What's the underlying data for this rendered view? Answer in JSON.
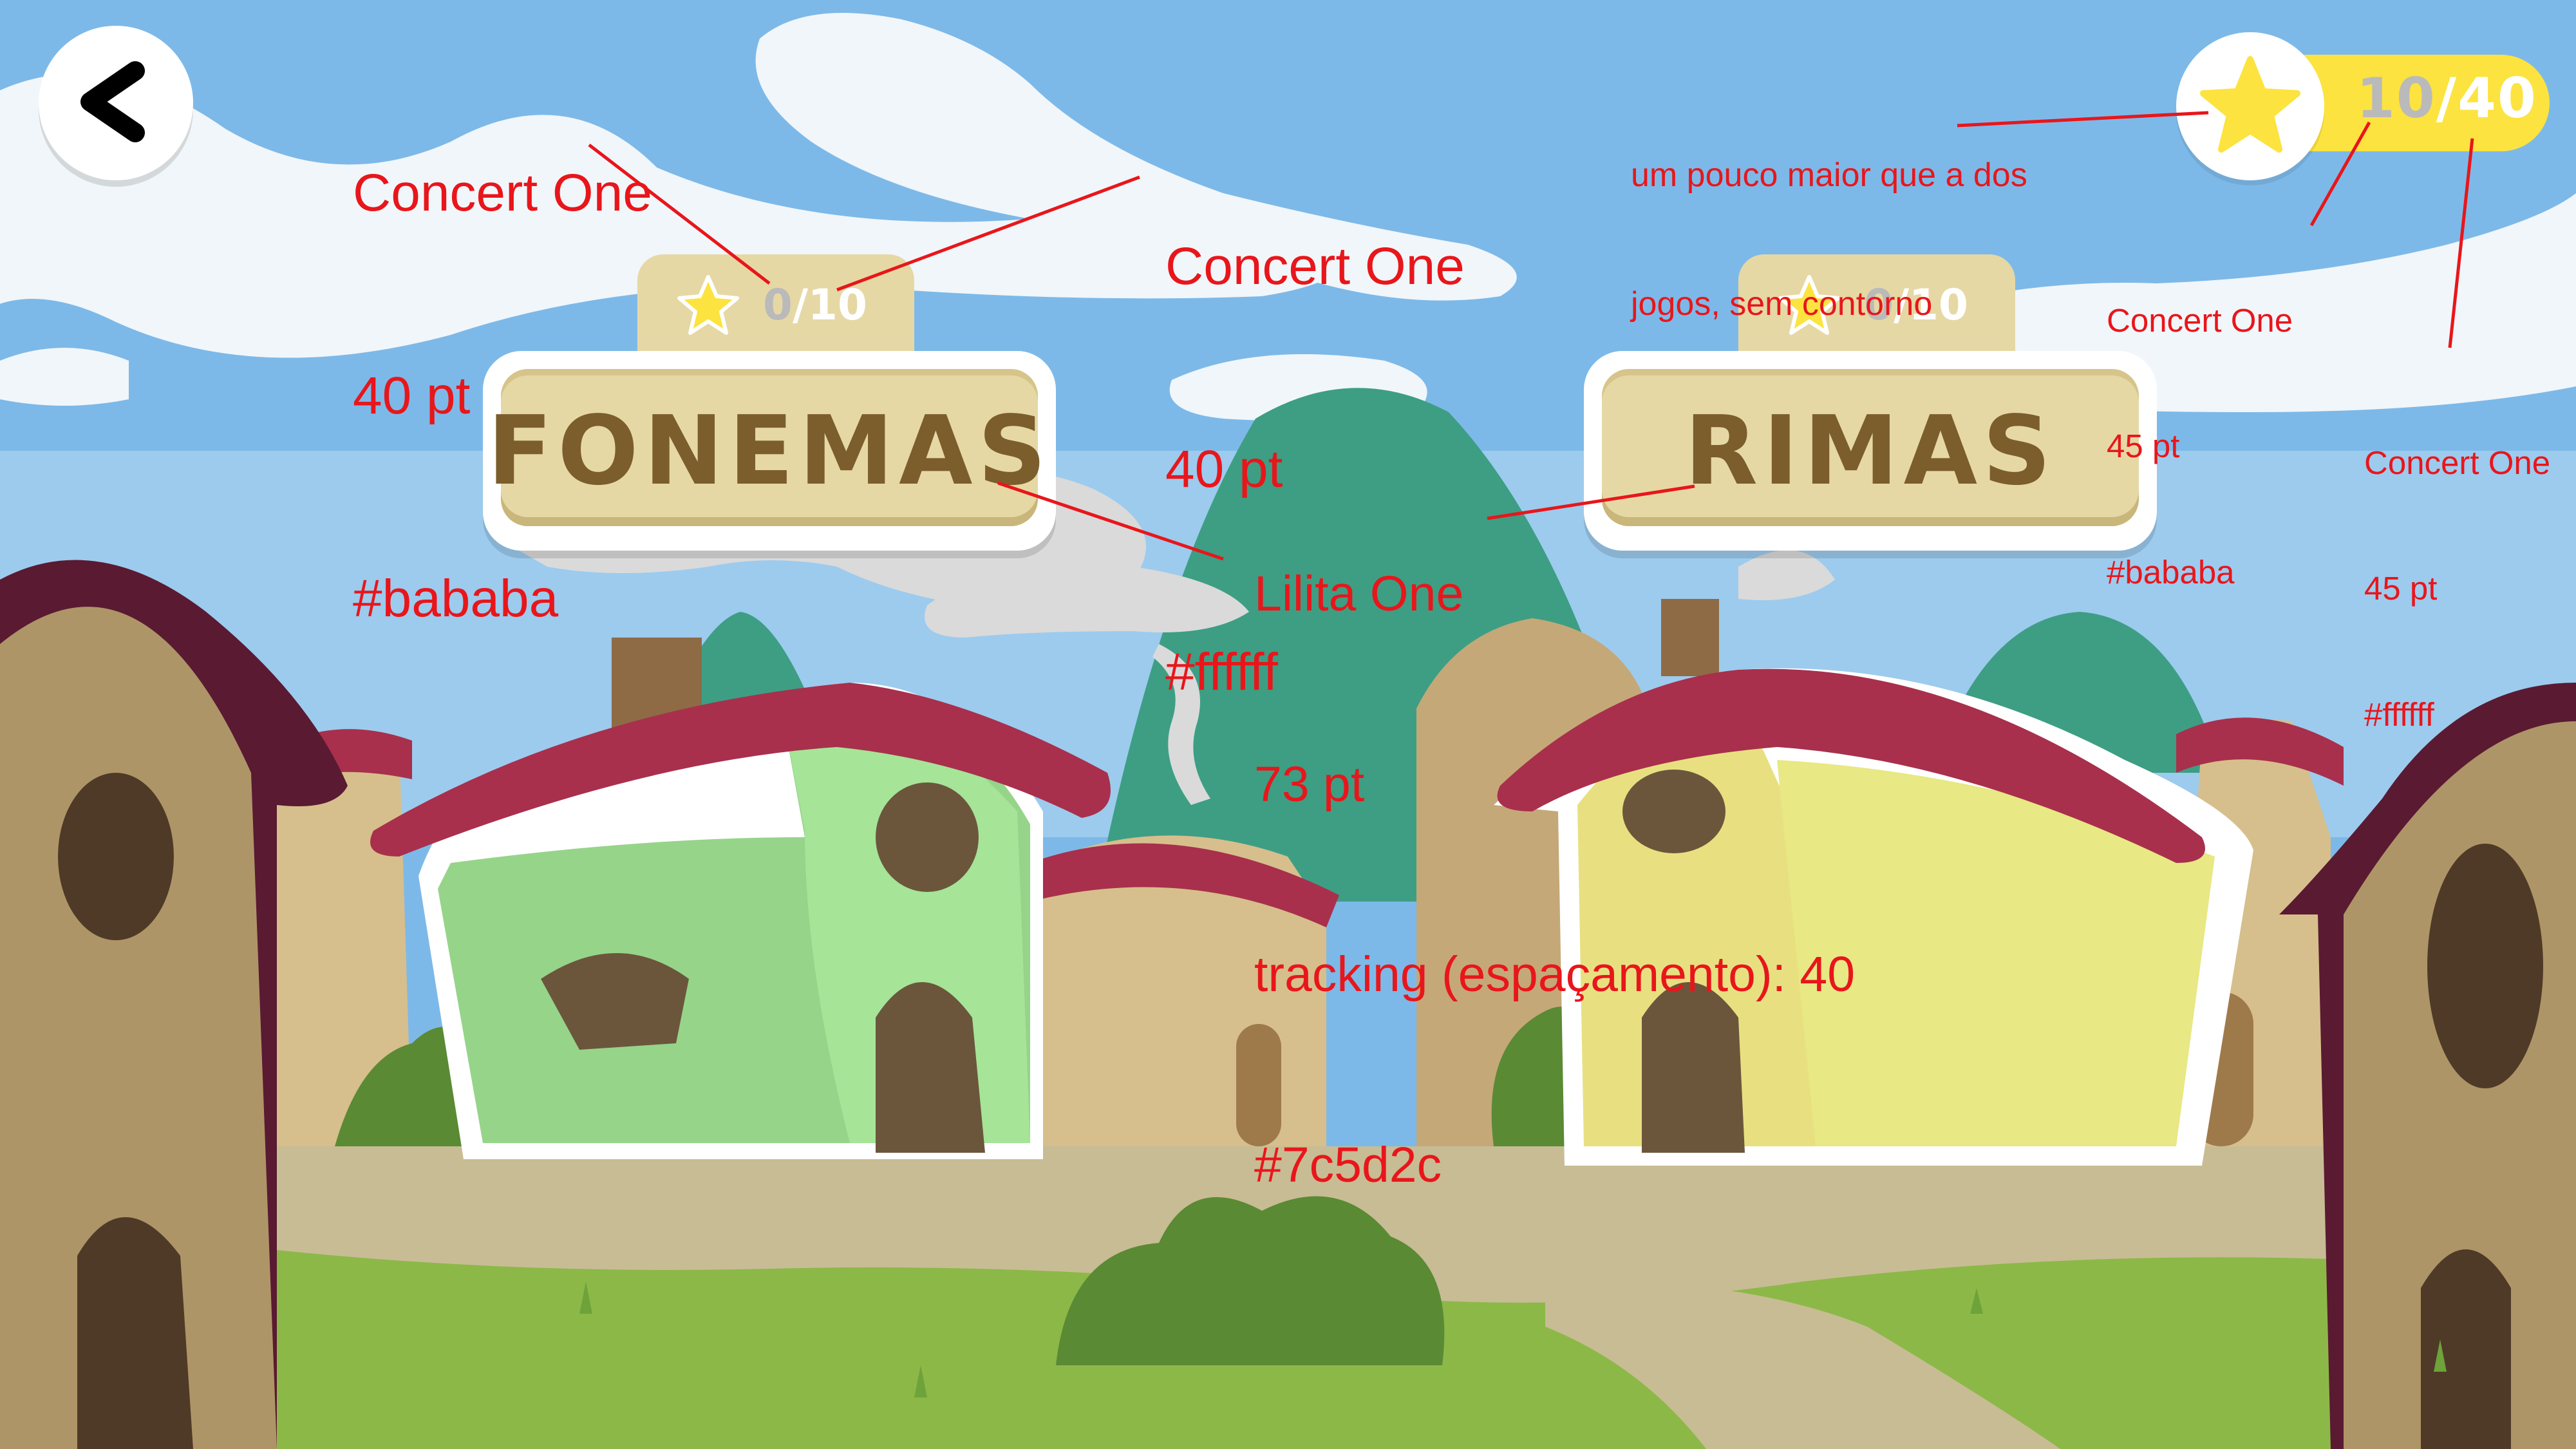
{
  "header": {
    "back_button_label": "<",
    "total_score": {
      "earned": "10",
      "separator": "/",
      "max": "40"
    }
  },
  "games": [
    {
      "id": "fonemas",
      "title": "FONEMAS",
      "score": {
        "earned": "0",
        "separator": "/",
        "max": "10"
      }
    },
    {
      "id": "rimas",
      "title": "RIMAS",
      "score": {
        "earned": "0",
        "separator": "/",
        "max": "10"
      }
    }
  ],
  "annotations": {
    "tab_score_grey": [
      "Concert One",
      "40 pt",
      "#bababa"
    ],
    "tab_score_white": [
      "Concert One",
      "40 pt",
      "#ffffff"
    ],
    "title_font": [
      "Lilita One",
      "73 pt",
      "tracking (espaçamento): 40",
      "#7c5d2c"
    ],
    "star_note": [
      "um pouco maior que a dos",
      "jogos, sem contorno"
    ],
    "total_score_grey": [
      "Concert One",
      "45 pt",
      "#bababa"
    ],
    "total_score_white": [
      "Concert One",
      "45 pt",
      "#ffffff"
    ]
  },
  "colors": {
    "sky": "#7db9e8",
    "star": "#fce33f",
    "score_grey": "#bababa",
    "score_white": "#ffffff",
    "title": "#7c5d2c",
    "plaque": "#e6d8a4",
    "annotation": "#e8161b"
  },
  "icons": [
    "back-chevron-icon",
    "star-icon"
  ]
}
